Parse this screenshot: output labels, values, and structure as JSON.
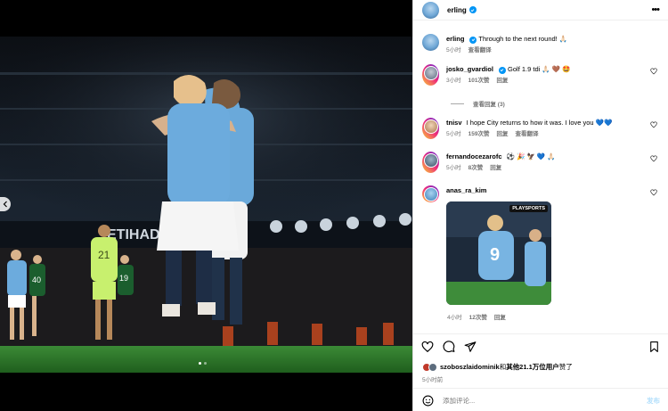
{
  "post": {
    "author": "erling",
    "caption": "Through to the next round! 🙏🏻",
    "caption_time": "5小时",
    "see_translation": "查看翻译"
  },
  "photo": {
    "shirt_numbers": [
      "21",
      "19",
      "40"
    ],
    "stadium_text": "ETIHAD"
  },
  "comments": [
    {
      "user": "josko_gvardiol",
      "verified": true,
      "text": "Golf 1.9 tdi 🙏🏻 🤎 🤩",
      "time": "3小时",
      "likes": "101次赞",
      "reply": "回复",
      "view_replies": "查看回复 (3)"
    },
    {
      "user": "tnisv",
      "verified": false,
      "text": "I hope City returns to how it was. I love you 💙💙",
      "time": "5小时",
      "likes": "159次赞",
      "reply": "回复",
      "translate": "查看翻译"
    },
    {
      "user": "fernandocezarofc",
      "verified": false,
      "text": "⚽ 🎉 🦅 💙 🙏🏻",
      "time": "5小时",
      "likes": "8次赞",
      "reply": "回复"
    },
    {
      "user": "anas_ra_kim",
      "verified": false,
      "time": "4小时",
      "likes": "12次赞",
      "reply": "回复",
      "gif_tag": "PLAYSPORTS",
      "gif_number": "9"
    }
  ],
  "likes": {
    "first_liker": "szoboszlaidominik",
    "connector": "和",
    "others": "其他21.1万位用户",
    "suffix": "赞了",
    "time": "5小时前"
  },
  "composer": {
    "placeholder": "添加评论...",
    "post_label": "发布"
  },
  "colors": {
    "verified": "#0095f6",
    "city_blue": "#6cabdd",
    "pitch": "#2d7a2b",
    "meta_gray": "#737373"
  },
  "icons": [
    "more-icon",
    "heart-icon",
    "comment-icon",
    "share-icon",
    "save-icon",
    "emoji-icon",
    "chevron-left-icon",
    "verified-icon"
  ]
}
